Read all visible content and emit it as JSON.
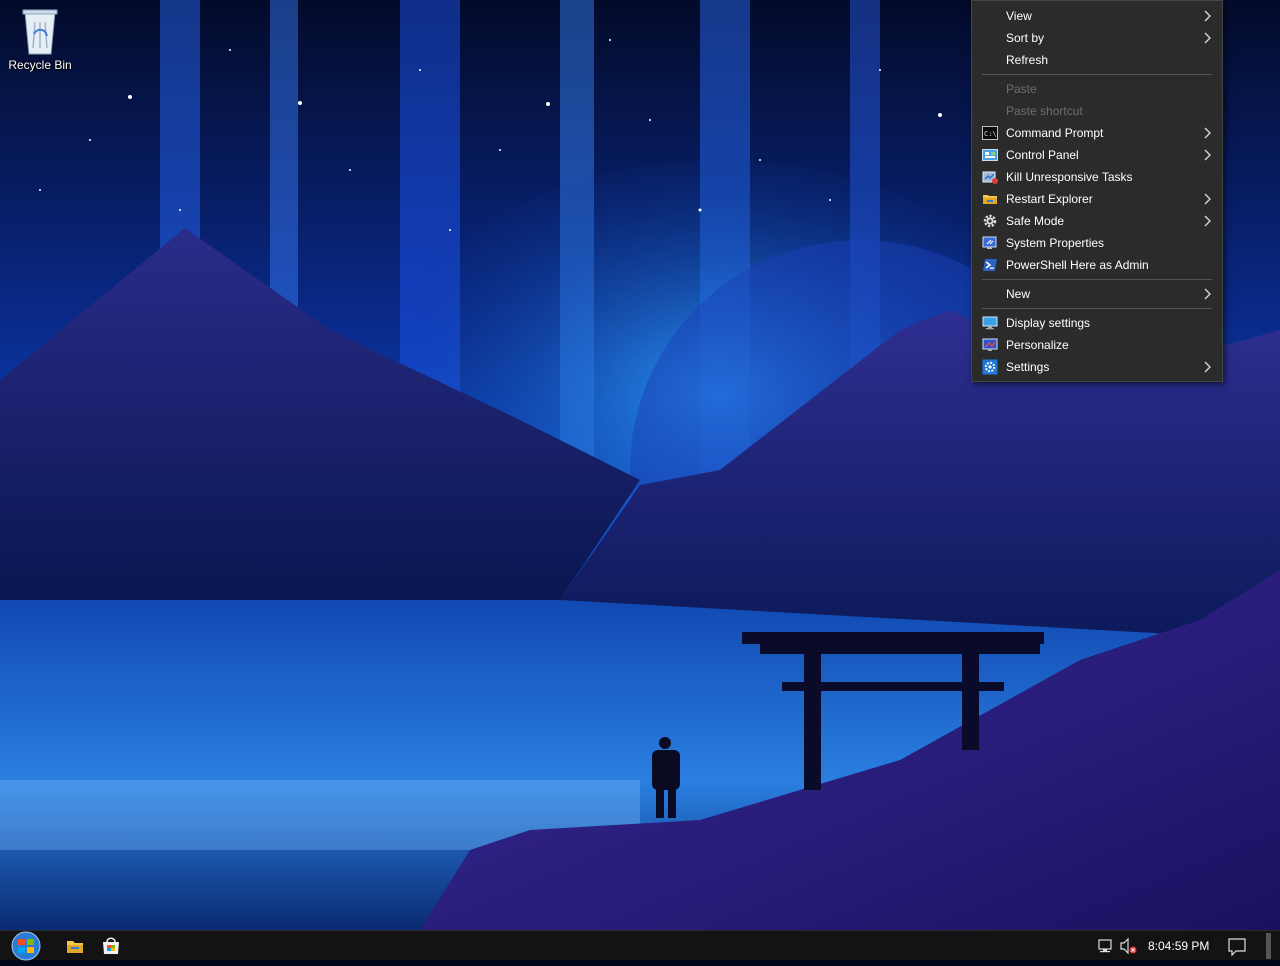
{
  "desktop": {
    "recycle_bin": {
      "label": "Recycle Bin",
      "icon": "recycle-bin-icon"
    }
  },
  "context_menu": {
    "items": [
      {
        "label": "View",
        "submenu": true,
        "enabled": true,
        "icon": null
      },
      {
        "label": "Sort by",
        "submenu": true,
        "enabled": true,
        "icon": null
      },
      {
        "label": "Refresh",
        "submenu": false,
        "enabled": true,
        "icon": null
      },
      {
        "separator": true
      },
      {
        "label": "Paste",
        "submenu": false,
        "enabled": false,
        "icon": null
      },
      {
        "label": "Paste shortcut",
        "submenu": false,
        "enabled": false,
        "icon": null
      },
      {
        "label": "Command Prompt",
        "submenu": true,
        "enabled": true,
        "icon": "command-prompt-icon"
      },
      {
        "label": "Control Panel",
        "submenu": true,
        "enabled": true,
        "icon": "control-panel-icon"
      },
      {
        "label": "Kill Unresponsive Tasks",
        "submenu": false,
        "enabled": true,
        "icon": "kill-tasks-icon"
      },
      {
        "label": "Restart Explorer",
        "submenu": true,
        "enabled": true,
        "icon": "folder-icon"
      },
      {
        "label": "Safe Mode",
        "submenu": true,
        "enabled": true,
        "icon": "gear-icon"
      },
      {
        "label": "System Properties",
        "submenu": false,
        "enabled": true,
        "icon": "system-properties-icon"
      },
      {
        "label": "PowerShell Here as Admin",
        "submenu": false,
        "enabled": true,
        "icon": "powershell-icon"
      },
      {
        "separator": true
      },
      {
        "label": "New",
        "submenu": true,
        "enabled": true,
        "icon": null
      },
      {
        "separator": true
      },
      {
        "label": "Display settings",
        "submenu": false,
        "enabled": true,
        "icon": "display-icon"
      },
      {
        "label": "Personalize",
        "submenu": false,
        "enabled": true,
        "icon": "personalize-icon"
      },
      {
        "label": "Settings",
        "submenu": true,
        "enabled": true,
        "icon": "settings-gear-icon"
      }
    ]
  },
  "taskbar": {
    "start_icon": "windows-start-orb-icon",
    "pinned": [
      "file-explorer-icon",
      "store-icon"
    ],
    "tray": {
      "icons": [
        "network-icon",
        "volume-muted-icon"
      ],
      "clock": "8:04:59 PM",
      "notification_icon": "action-center-icon"
    }
  },
  "colors": {
    "menu_bg": "#2b2b2b",
    "menu_text": "#ffffff",
    "menu_disabled": "#6d6d6d",
    "taskbar_bg": "#131313",
    "wallpaper_accent": "#1f6bff"
  }
}
